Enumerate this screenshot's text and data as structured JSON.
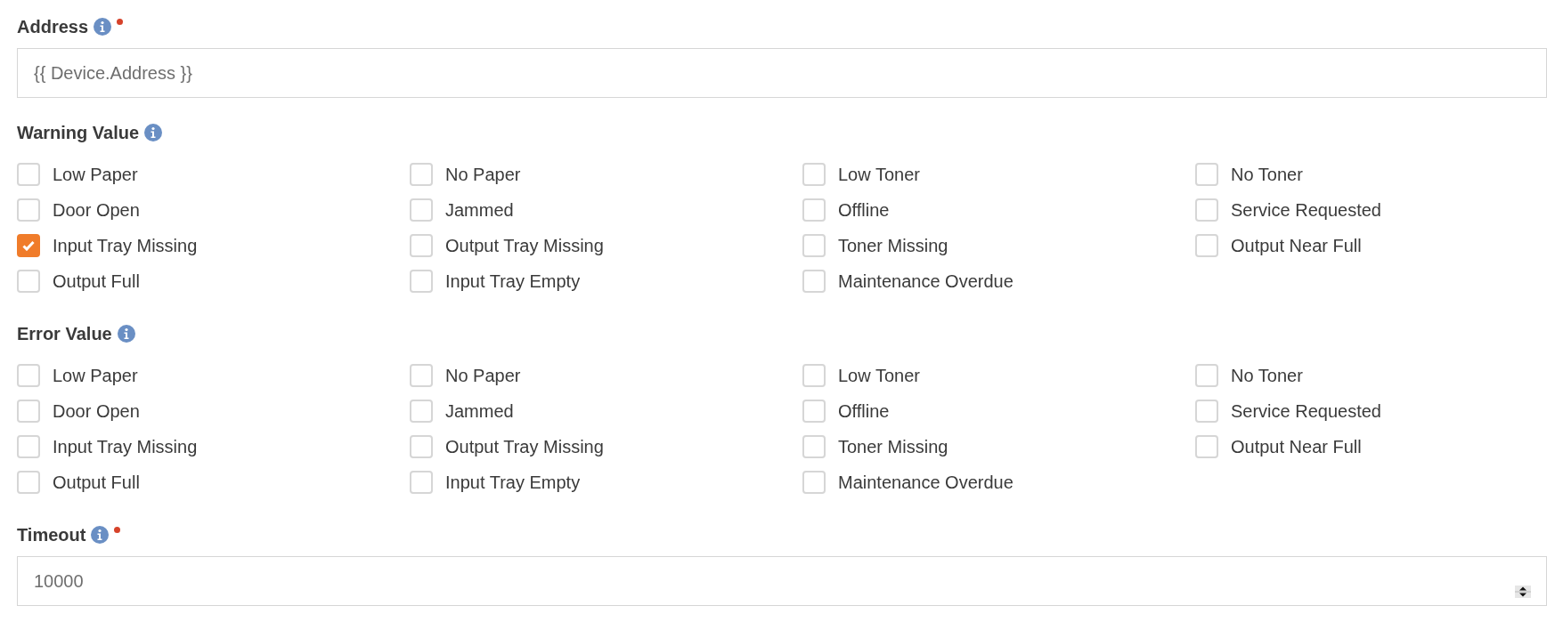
{
  "sections": [
    {
      "kind": "text",
      "label": "Address",
      "info": true,
      "required": true,
      "value": "{{ Device.Address }}"
    },
    {
      "kind": "checkboxes",
      "label": "Warning Value",
      "info": true,
      "required": false,
      "options": [
        {
          "label": "Low Paper",
          "checked": false
        },
        {
          "label": "No Paper",
          "checked": false
        },
        {
          "label": "Low Toner",
          "checked": false
        },
        {
          "label": "No Toner",
          "checked": false
        },
        {
          "label": "Door Open",
          "checked": false
        },
        {
          "label": "Jammed",
          "checked": false
        },
        {
          "label": "Offline",
          "checked": false
        },
        {
          "label": "Service Requested",
          "checked": false
        },
        {
          "label": "Input Tray Missing",
          "checked": true
        },
        {
          "label": "Output Tray Missing",
          "checked": false
        },
        {
          "label": "Toner Missing",
          "checked": false
        },
        {
          "label": "Output Near Full",
          "checked": false
        },
        {
          "label": "Output Full",
          "checked": false
        },
        {
          "label": "Input Tray Empty",
          "checked": false
        },
        {
          "label": "Maintenance Overdue",
          "checked": false
        }
      ]
    },
    {
      "kind": "checkboxes",
      "label": "Error Value",
      "info": true,
      "required": false,
      "options": [
        {
          "label": "Low Paper",
          "checked": false
        },
        {
          "label": "No Paper",
          "checked": false
        },
        {
          "label": "Low Toner",
          "checked": false
        },
        {
          "label": "No Toner",
          "checked": false
        },
        {
          "label": "Door Open",
          "checked": false
        },
        {
          "label": "Jammed",
          "checked": false
        },
        {
          "label": "Offline",
          "checked": false
        },
        {
          "label": "Service Requested",
          "checked": false
        },
        {
          "label": "Input Tray Missing",
          "checked": false
        },
        {
          "label": "Output Tray Missing",
          "checked": false
        },
        {
          "label": "Toner Missing",
          "checked": false
        },
        {
          "label": "Output Near Full",
          "checked": false
        },
        {
          "label": "Output Full",
          "checked": false
        },
        {
          "label": "Input Tray Empty",
          "checked": false
        },
        {
          "label": "Maintenance Overdue",
          "checked": false
        }
      ]
    },
    {
      "kind": "number",
      "label": "Timeout",
      "info": true,
      "required": true,
      "value": "10000"
    }
  ]
}
